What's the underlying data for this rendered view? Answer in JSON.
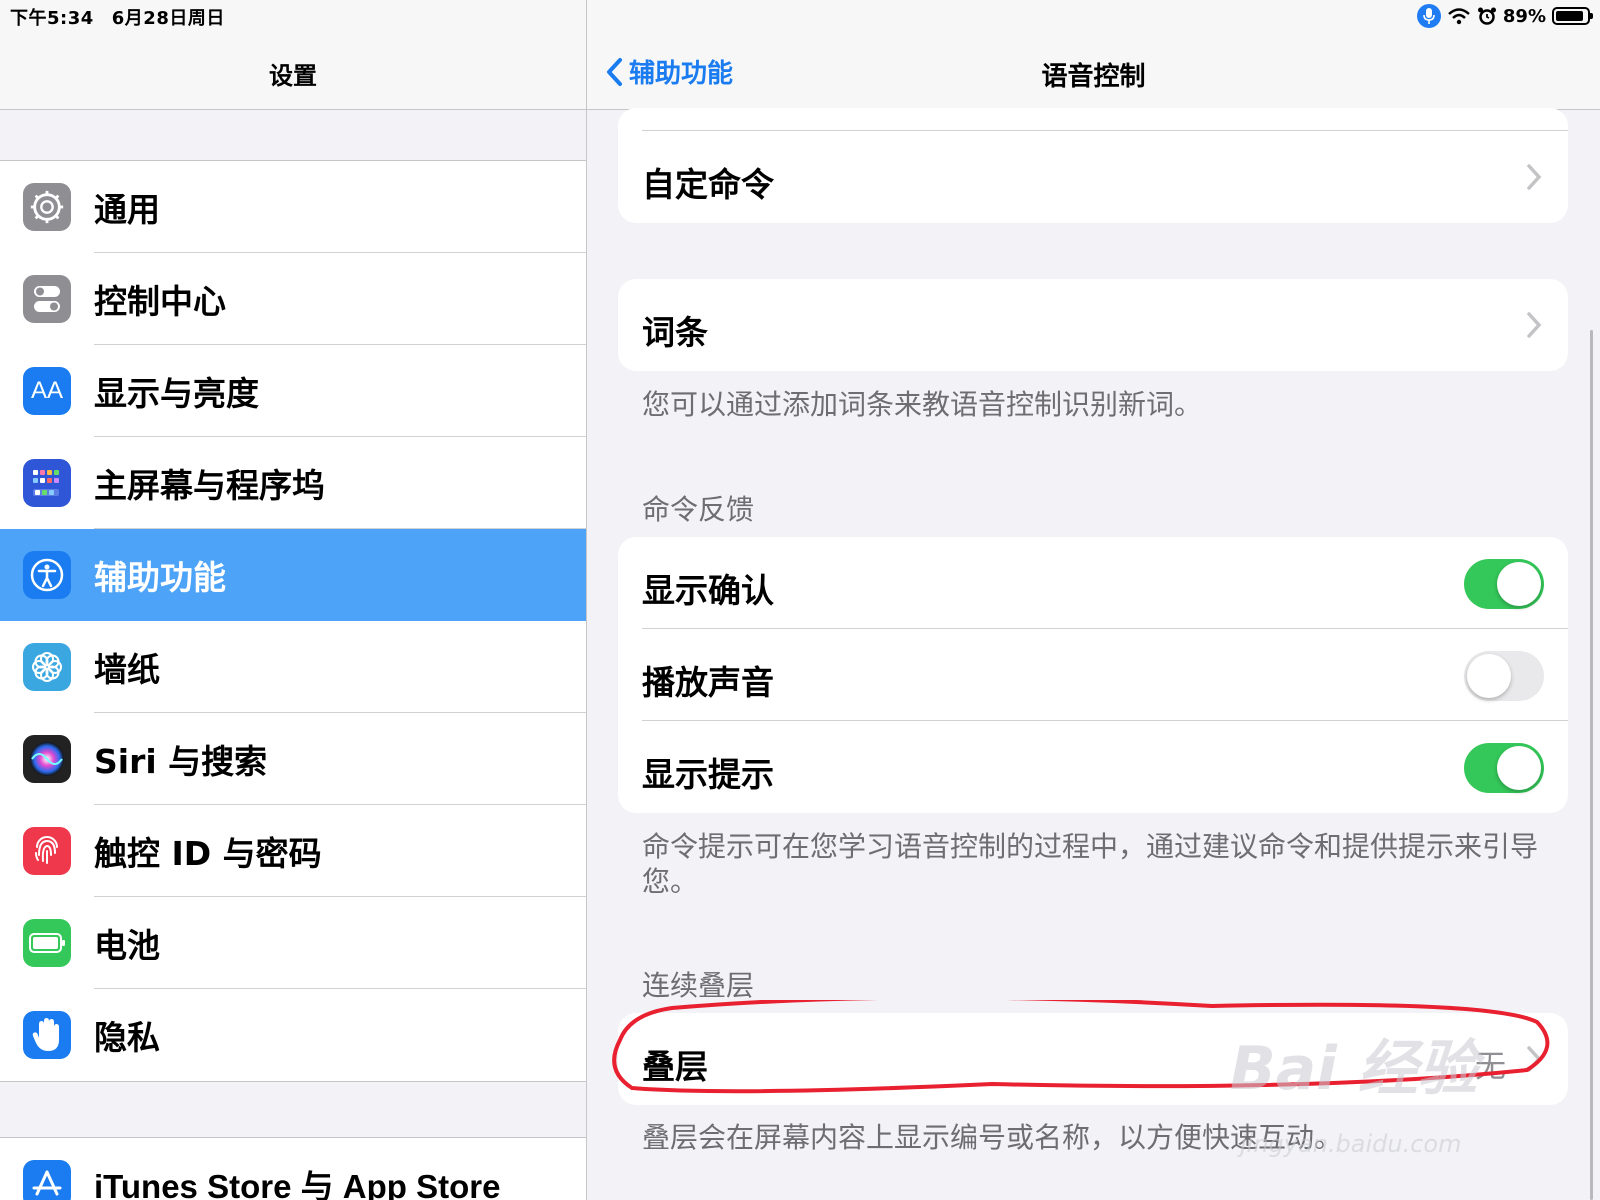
{
  "status_bar": {
    "time": "下午5:34",
    "date": "6月28日周日",
    "battery": "89%",
    "battery_level": 0.89
  },
  "left_nav": {
    "title": "设置"
  },
  "sidebar": {
    "items": [
      {
        "label": "通用",
        "icon": "gear-icon",
        "color": "#8e8e93"
      },
      {
        "label": "控制中心",
        "icon": "switches-icon",
        "color": "#8e8e93"
      },
      {
        "label": "显示与亮度",
        "icon": "text-size-icon",
        "color": "#1a7cf0",
        "icon_text": "AA"
      },
      {
        "label": "主屏幕与程序坞",
        "icon": "app-grid-icon",
        "color": "#2f56d6"
      },
      {
        "label": "辅助功能",
        "icon": "accessibility-icon",
        "color": "#1a7cf0",
        "selected": true
      },
      {
        "label": "墙纸",
        "icon": "flower-icon",
        "color": "#3aa7e0"
      },
      {
        "label": "Siri 与搜索",
        "icon": "siri-icon",
        "color": "#222222"
      },
      {
        "label": "触控 ID 与密码",
        "icon": "fingerprint-icon",
        "color": "#f0384c"
      },
      {
        "label": "电池",
        "icon": "battery-icon",
        "color": "#34c759"
      },
      {
        "label": "隐私",
        "icon": "hand-icon",
        "color": "#1a7cf0"
      }
    ],
    "store_item": {
      "label": "iTunes Store 与 App Store",
      "icon": "app-store-icon",
      "color": "#1a7cf0"
    }
  },
  "right_nav": {
    "back_label": "辅助功能",
    "title": "语音控制"
  },
  "content": {
    "custom_commands": "自定命令",
    "vocabulary": "词条",
    "vocabulary_footer": "您可以通过添加词条来教语音控制识别新词。",
    "feedback_header": "命令反馈",
    "feedback_rows": [
      {
        "label": "显示确认",
        "on": true
      },
      {
        "label": "播放声音",
        "on": false
      },
      {
        "label": "显示提示",
        "on": true
      }
    ],
    "feedback_footer": "命令提示可在您学习语音控制的过程中，通过建议命令和提供提示来引导您。",
    "overlay_header": "连续叠层",
    "overlay_label": "叠层",
    "overlay_value": "无",
    "overlay_footer": "叠层会在屏幕内容上显示编号或名称，以方便快速互动。"
  },
  "colors": {
    "accent": "#1a7cf0",
    "selected_row": "#4da3f7",
    "toggle_on": "#34c759",
    "annotation": "#e8202f"
  },
  "watermark": {
    "brand": "Bai 经验",
    "url": "jingyan.baidu.com"
  }
}
